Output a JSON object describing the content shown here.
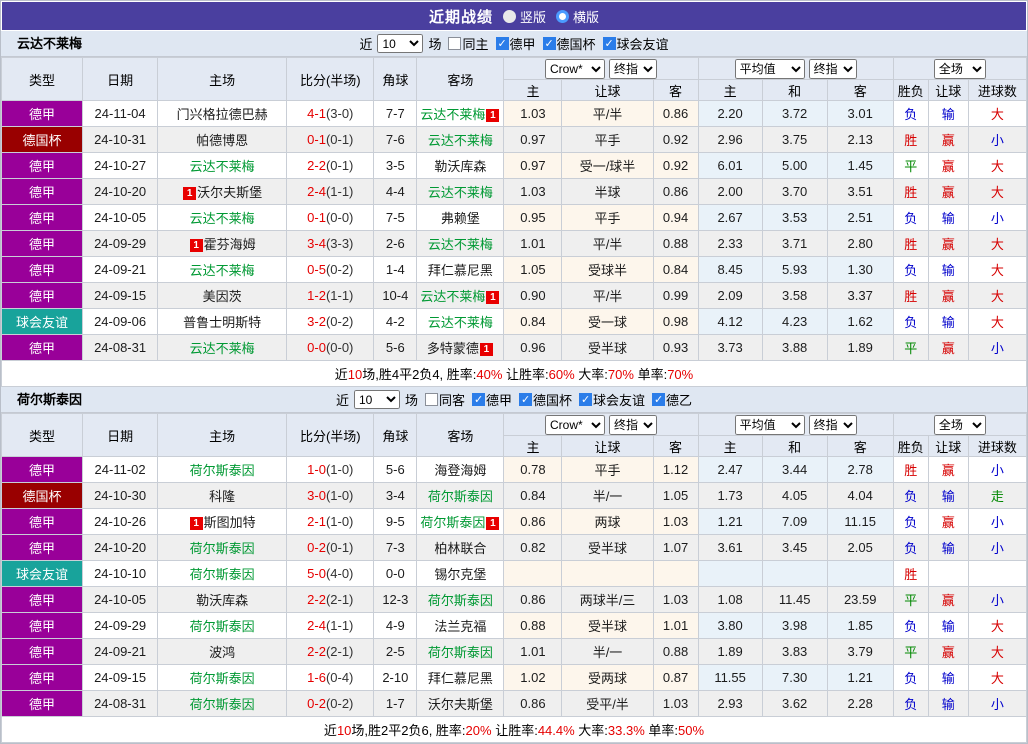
{
  "title_bar": {
    "title": "近期战绩",
    "vertical_label": "竖版",
    "horizontal_label": "横版"
  },
  "table_headers": {
    "left": [
      "类型",
      "日期",
      "主场",
      "比分(半场)",
      "角球",
      "客场"
    ],
    "sub": [
      "主",
      "让球",
      "客",
      "主",
      "和",
      "客",
      "胜负",
      "让球",
      "进球数"
    ],
    "selects": {
      "odds_source": "Crow*",
      "final_index1": "终指",
      "average": "平均值",
      "final_index2": "终指",
      "full_match": "全场"
    }
  },
  "colors": {
    "titlebar_bg": "#4a3f9f",
    "league_badge": {
      "德甲": "#990099",
      "德国杯": "#990000",
      "球会友谊": "#18a39b",
      "德乙": "#336699"
    },
    "focal_team": "#009933",
    "score_red": "#e60000",
    "result_red": "#d60000",
    "result_blue": "#0000cc",
    "result_green": "#008800",
    "checkbox_blue": "#2b7de9"
  },
  "sections": [
    {
      "team": "云达不莱梅",
      "filter": {
        "near": "近",
        "count": "10",
        "unit": "场",
        "same": {
          "label": "同主",
          "checked": false
        },
        "leagues": [
          {
            "label": "德甲",
            "checked": true
          },
          {
            "label": "德国杯",
            "checked": true
          },
          {
            "label": "球会友谊",
            "checked": true
          }
        ]
      },
      "rows": [
        {
          "league": "德甲",
          "date": "24-11-04",
          "home": {
            "name": "门兴格拉德巴赫",
            "focal": false,
            "card": "",
            "card_pos": ""
          },
          "score": "4-1",
          "half": "(3-0)",
          "corners": "7-7",
          "away": {
            "name": "云达不莱梅",
            "focal": true,
            "card": "1",
            "card_pos": "after"
          },
          "odds": [
            "1.03",
            "平/半",
            "0.86",
            "2.20",
            "3.72",
            "3.01"
          ],
          "results": [
            "负",
            "输",
            "大"
          ]
        },
        {
          "league": "德国杯",
          "date": "24-10-31",
          "home": {
            "name": "帕德博恩",
            "focal": false,
            "card": "",
            "card_pos": ""
          },
          "score": "0-1",
          "half": "(0-1)",
          "corners": "7-6",
          "away": {
            "name": "云达不莱梅",
            "focal": true,
            "card": "",
            "card_pos": ""
          },
          "odds": [
            "0.97",
            "平手",
            "0.92",
            "2.96",
            "3.75",
            "2.13"
          ],
          "results": [
            "胜",
            "赢",
            "小"
          ]
        },
        {
          "league": "德甲",
          "date": "24-10-27",
          "home": {
            "name": "云达不莱梅",
            "focal": true,
            "card": "",
            "card_pos": ""
          },
          "score": "2-2",
          "half": "(0-1)",
          "corners": "3-5",
          "away": {
            "name": "勒沃库森",
            "focal": false,
            "card": "",
            "card_pos": ""
          },
          "odds": [
            "0.97",
            "受一/球半",
            "0.92",
            "6.01",
            "5.00",
            "1.45"
          ],
          "results": [
            "平",
            "赢",
            "大"
          ]
        },
        {
          "league": "德甲",
          "date": "24-10-20",
          "home": {
            "name": "沃尔夫斯堡",
            "focal": false,
            "card": "1",
            "card_pos": "before"
          },
          "score": "2-4",
          "half": "(1-1)",
          "corners": "4-4",
          "away": {
            "name": "云达不莱梅",
            "focal": true,
            "card": "",
            "card_pos": ""
          },
          "odds": [
            "1.03",
            "半球",
            "0.86",
            "2.00",
            "3.70",
            "3.51"
          ],
          "results": [
            "胜",
            "赢",
            "大"
          ]
        },
        {
          "league": "德甲",
          "date": "24-10-05",
          "home": {
            "name": "云达不莱梅",
            "focal": true,
            "card": "",
            "card_pos": ""
          },
          "score": "0-1",
          "half": "(0-0)",
          "corners": "7-5",
          "away": {
            "name": "弗赖堡",
            "focal": false,
            "card": "",
            "card_pos": ""
          },
          "odds": [
            "0.95",
            "平手",
            "0.94",
            "2.67",
            "3.53",
            "2.51"
          ],
          "results": [
            "负",
            "输",
            "小"
          ]
        },
        {
          "league": "德甲",
          "date": "24-09-29",
          "home": {
            "name": "霍芬海姆",
            "focal": false,
            "card": "1",
            "card_pos": "before"
          },
          "score": "3-4",
          "half": "(3-3)",
          "corners": "2-6",
          "away": {
            "name": "云达不莱梅",
            "focal": true,
            "card": "",
            "card_pos": ""
          },
          "odds": [
            "1.01",
            "平/半",
            "0.88",
            "2.33",
            "3.71",
            "2.80"
          ],
          "results": [
            "胜",
            "赢",
            "大"
          ]
        },
        {
          "league": "德甲",
          "date": "24-09-21",
          "home": {
            "name": "云达不莱梅",
            "focal": true,
            "card": "",
            "card_pos": ""
          },
          "score": "0-5",
          "half": "(0-2)",
          "corners": "1-4",
          "away": {
            "name": "拜仁慕尼黑",
            "focal": false,
            "card": "",
            "card_pos": ""
          },
          "odds": [
            "1.05",
            "受球半",
            "0.84",
            "8.45",
            "5.93",
            "1.30"
          ],
          "results": [
            "负",
            "输",
            "大"
          ]
        },
        {
          "league": "德甲",
          "date": "24-09-15",
          "home": {
            "name": "美因茨",
            "focal": false,
            "card": "",
            "card_pos": ""
          },
          "score": "1-2",
          "half": "(1-1)",
          "corners": "10-4",
          "away": {
            "name": "云达不莱梅",
            "focal": true,
            "card": "1",
            "card_pos": "after"
          },
          "odds": [
            "0.90",
            "平/半",
            "0.99",
            "2.09",
            "3.58",
            "3.37"
          ],
          "results": [
            "胜",
            "赢",
            "大"
          ]
        },
        {
          "league": "球会友谊",
          "date": "24-09-06",
          "home": {
            "name": "普鲁士明斯特",
            "focal": false,
            "card": "",
            "card_pos": ""
          },
          "score": "3-2",
          "half": "(0-2)",
          "corners": "4-2",
          "away": {
            "name": "云达不莱梅",
            "focal": true,
            "card": "",
            "card_pos": ""
          },
          "odds": [
            "0.84",
            "受一球",
            "0.98",
            "4.12",
            "4.23",
            "1.62"
          ],
          "results": [
            "负",
            "输",
            "大"
          ]
        },
        {
          "league": "德甲",
          "date": "24-08-31",
          "home": {
            "name": "云达不莱梅",
            "focal": true,
            "card": "",
            "card_pos": ""
          },
          "score": "0-0",
          "half": "(0-0)",
          "corners": "5-6",
          "away": {
            "name": "多特蒙德",
            "focal": false,
            "card": "1",
            "card_pos": "after"
          },
          "odds": [
            "0.96",
            "受半球",
            "0.93",
            "3.73",
            "3.88",
            "1.89"
          ],
          "results": [
            "平",
            "赢",
            "小"
          ]
        }
      ],
      "summary": [
        {
          "text": "近"
        },
        {
          "text": "10",
          "red": true
        },
        {
          "text": "场,胜4平2负4, 胜率:"
        },
        {
          "text": "40%",
          "red": true
        },
        {
          "text": " 让胜率:"
        },
        {
          "text": "60%",
          "red": true
        },
        {
          "text": " 大率:"
        },
        {
          "text": "70%",
          "red": true
        },
        {
          "text": " 单率:"
        },
        {
          "text": "70%",
          "red": true
        }
      ]
    },
    {
      "team": "荷尔斯泰因",
      "filter": {
        "near": "近",
        "count": "10",
        "unit": "场",
        "same": {
          "label": "同客",
          "checked": false
        },
        "leagues": [
          {
            "label": "德甲",
            "checked": true
          },
          {
            "label": "德国杯",
            "checked": true
          },
          {
            "label": "球会友谊",
            "checked": true
          },
          {
            "label": "德乙",
            "checked": true
          }
        ]
      },
      "rows": [
        {
          "league": "德甲",
          "date": "24-11-02",
          "home": {
            "name": "荷尔斯泰因",
            "focal": true,
            "card": "",
            "card_pos": ""
          },
          "score": "1-0",
          "half": "(1-0)",
          "corners": "5-6",
          "away": {
            "name": "海登海姆",
            "focal": false,
            "card": "",
            "card_pos": ""
          },
          "odds": [
            "0.78",
            "平手",
            "1.12",
            "2.47",
            "3.44",
            "2.78"
          ],
          "results": [
            "胜",
            "赢",
            "小"
          ]
        },
        {
          "league": "德国杯",
          "date": "24-10-30",
          "home": {
            "name": "科隆",
            "focal": false,
            "card": "",
            "card_pos": ""
          },
          "score": "3-0",
          "half": "(1-0)",
          "corners": "3-4",
          "away": {
            "name": "荷尔斯泰因",
            "focal": true,
            "card": "",
            "card_pos": ""
          },
          "odds": [
            "0.84",
            "半/一",
            "1.05",
            "1.73",
            "4.05",
            "4.04"
          ],
          "results": [
            "负",
            "输",
            "走"
          ]
        },
        {
          "league": "德甲",
          "date": "24-10-26",
          "home": {
            "name": "斯图加特",
            "focal": false,
            "card": "1",
            "card_pos": "before"
          },
          "score": "2-1",
          "half": "(1-0)",
          "corners": "9-5",
          "away": {
            "name": "荷尔斯泰因",
            "focal": true,
            "card": "1",
            "card_pos": "after"
          },
          "odds": [
            "0.86",
            "两球",
            "1.03",
            "1.21",
            "7.09",
            "11.15"
          ],
          "results": [
            "负",
            "赢",
            "小"
          ]
        },
        {
          "league": "德甲",
          "date": "24-10-20",
          "home": {
            "name": "荷尔斯泰因",
            "focal": true,
            "card": "",
            "card_pos": ""
          },
          "score": "0-2",
          "half": "(0-1)",
          "corners": "7-3",
          "away": {
            "name": "柏林联合",
            "focal": false,
            "card": "",
            "card_pos": ""
          },
          "odds": [
            "0.82",
            "受半球",
            "1.07",
            "3.61",
            "3.45",
            "2.05"
          ],
          "results": [
            "负",
            "输",
            "小"
          ]
        },
        {
          "league": "球会友谊",
          "date": "24-10-10",
          "home": {
            "name": "荷尔斯泰因",
            "focal": true,
            "card": "",
            "card_pos": ""
          },
          "score": "5-0",
          "half": "(4-0)",
          "corners": "0-0",
          "away": {
            "name": "锡尔克堡",
            "focal": false,
            "card": "",
            "card_pos": ""
          },
          "odds": [
            "",
            "",
            "",
            "",
            "",
            ""
          ],
          "results": [
            "胜",
            "",
            ""
          ]
        },
        {
          "league": "德甲",
          "date": "24-10-05",
          "home": {
            "name": "勒沃库森",
            "focal": false,
            "card": "",
            "card_pos": ""
          },
          "score": "2-2",
          "half": "(2-1)",
          "corners": "12-3",
          "away": {
            "name": "荷尔斯泰因",
            "focal": true,
            "card": "",
            "card_pos": ""
          },
          "odds": [
            "0.86",
            "两球半/三",
            "1.03",
            "1.08",
            "11.45",
            "23.59"
          ],
          "results": [
            "平",
            "赢",
            "小"
          ]
        },
        {
          "league": "德甲",
          "date": "24-09-29",
          "home": {
            "name": "荷尔斯泰因",
            "focal": true,
            "card": "",
            "card_pos": ""
          },
          "score": "2-4",
          "half": "(1-1)",
          "corners": "4-9",
          "away": {
            "name": "法兰克福",
            "focal": false,
            "card": "",
            "card_pos": ""
          },
          "odds": [
            "0.88",
            "受半球",
            "1.01",
            "3.80",
            "3.98",
            "1.85"
          ],
          "results": [
            "负",
            "输",
            "大"
          ]
        },
        {
          "league": "德甲",
          "date": "24-09-21",
          "home": {
            "name": "波鸿",
            "focal": false,
            "card": "",
            "card_pos": ""
          },
          "score": "2-2",
          "half": "(2-1)",
          "corners": "2-5",
          "away": {
            "name": "荷尔斯泰因",
            "focal": true,
            "card": "",
            "card_pos": ""
          },
          "odds": [
            "1.01",
            "半/一",
            "0.88",
            "1.89",
            "3.83",
            "3.79"
          ],
          "results": [
            "平",
            "赢",
            "大"
          ]
        },
        {
          "league": "德甲",
          "date": "24-09-15",
          "home": {
            "name": "荷尔斯泰因",
            "focal": true,
            "card": "",
            "card_pos": ""
          },
          "score": "1-6",
          "half": "(0-4)",
          "corners": "2-10",
          "away": {
            "name": "拜仁慕尼黑",
            "focal": false,
            "card": "",
            "card_pos": ""
          },
          "odds": [
            "1.02",
            "受两球",
            "0.87",
            "11.55",
            "7.30",
            "1.21"
          ],
          "results": [
            "负",
            "输",
            "大"
          ]
        },
        {
          "league": "德甲",
          "date": "24-08-31",
          "home": {
            "name": "荷尔斯泰因",
            "focal": true,
            "card": "",
            "card_pos": ""
          },
          "score": "0-2",
          "half": "(0-2)",
          "corners": "1-7",
          "away": {
            "name": "沃尔夫斯堡",
            "focal": false,
            "card": "",
            "card_pos": ""
          },
          "odds": [
            "0.86",
            "受平/半",
            "1.03",
            "2.93",
            "3.62",
            "2.28"
          ],
          "results": [
            "负",
            "输",
            "小"
          ]
        }
      ],
      "summary": [
        {
          "text": "近"
        },
        {
          "text": "10",
          "red": true
        },
        {
          "text": "场,胜2平2负6, 胜率:"
        },
        {
          "text": "20%",
          "red": true
        },
        {
          "text": " 让胜率:"
        },
        {
          "text": "44.4%",
          "red": true
        },
        {
          "text": " 大率:"
        },
        {
          "text": "33.3%",
          "red": true
        },
        {
          "text": " 单率:"
        },
        {
          "text": "50%",
          "red": true
        }
      ]
    }
  ]
}
